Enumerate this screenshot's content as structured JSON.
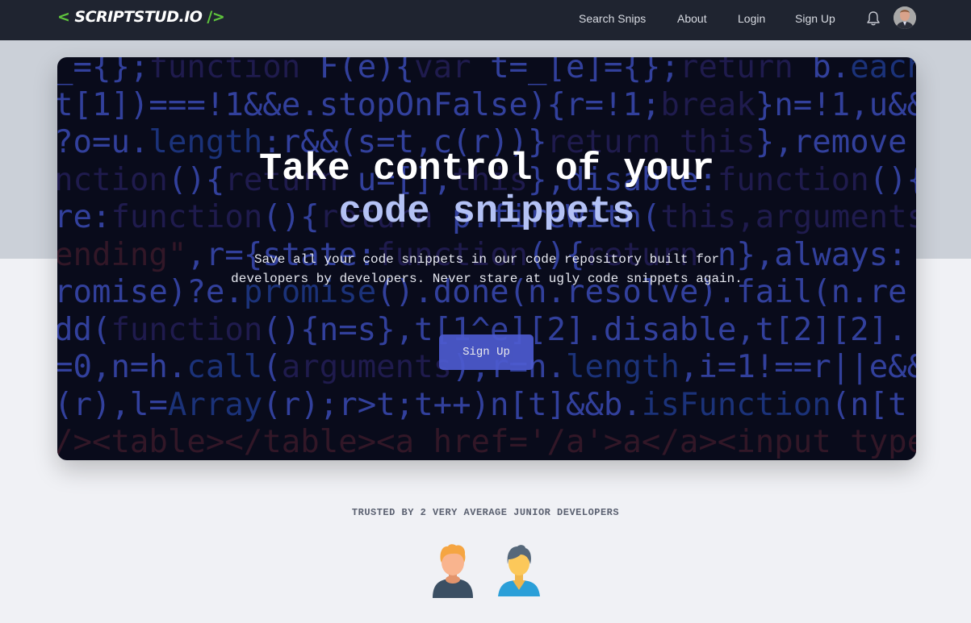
{
  "navbar": {
    "logo": {
      "open": "<",
      "name": "SCRIPTSTUD.IO",
      "close": "/>"
    },
    "links": [
      "Search Snips",
      "About",
      "Login",
      "Sign Up"
    ],
    "icons": [
      "bell-icon",
      "user-avatar"
    ]
  },
  "hero": {
    "title_line1": "Take control of your",
    "title_line2": "code snippets",
    "description": "Save all your code snippets in our code repository built for developers by developers. Never stare at ugly code snippets again.",
    "cta_label": "Sign Up",
    "code_background": [
      [
        [
          "b",
          "_={};"
        ],
        [
          "d",
          "function "
        ],
        [
          "b",
          "F(e){"
        ],
        [
          "d",
          "var "
        ],
        [
          "b",
          "t=_[e]={};"
        ],
        [
          "d",
          "return "
        ],
        [
          "b",
          "b."
        ],
        [
          "m",
          "each"
        ]
      ],
      [
        [
          "b",
          "t[1])===!1&&e.stopOnFalse){r=!1;"
        ],
        [
          "d",
          "break"
        ],
        [
          "b",
          "}n=!1,u&&"
        ]
      ],
      [
        [
          "b",
          "?o=u."
        ],
        [
          "m",
          "length"
        ],
        [
          "b",
          ":r&&(s=t,c(r))}"
        ],
        [
          "d",
          "return this"
        ],
        [
          "b",
          "},remove"
        ]
      ],
      [
        [
          "d",
          "nction"
        ],
        [
          "b",
          "(){"
        ],
        [
          "d",
          "return "
        ],
        [
          "b",
          "u=[],"
        ],
        [
          "d",
          "this"
        ],
        [
          "b",
          "},disable:"
        ],
        [
          "d",
          "function"
        ],
        [
          "b",
          "(){"
        ]
      ],
      [
        [
          "b",
          "re:"
        ],
        [
          "d",
          "function"
        ],
        [
          "b",
          "(){"
        ],
        [
          "d",
          "return "
        ],
        [
          "b",
          "p.fireWith("
        ],
        [
          "d",
          "this,arguments"
        ]
      ],
      [
        [
          "r",
          "ending\""
        ],
        [
          "b",
          ",r={state:"
        ],
        [
          "d",
          "function"
        ],
        [
          "b",
          "(){"
        ],
        [
          "d",
          "return "
        ],
        [
          "b",
          "n},always:"
        ]
      ],
      [
        [
          "b",
          "romise)?e."
        ],
        [
          "m",
          "promise"
        ],
        [
          "b",
          "().done(n.resolve).fail(n.re"
        ]
      ],
      [
        [
          "b",
          "dd("
        ],
        [
          "d",
          "function"
        ],
        [
          "b",
          "(){n=s},t[1^e][2].disable,t[2][2]."
        ]
      ],
      [
        [
          "b",
          "=0,n=h."
        ],
        [
          "m",
          "call"
        ],
        [
          "b",
          "("
        ],
        [
          "d",
          "arguments"
        ],
        [
          "b",
          "),r=n."
        ],
        [
          "m",
          "length"
        ],
        [
          "b",
          ",i=1!==r||e&&"
        ]
      ],
      [
        [
          "b",
          "(r),l="
        ],
        [
          "m",
          "Array"
        ],
        [
          "b",
          "(r);r>t;t++)n[t]&&b."
        ],
        [
          "m",
          "isFunction"
        ],
        [
          "b",
          "(n[t"
        ]
      ],
      [
        [
          "r",
          "/><table></table><a href='/a'>a</a><input type"
        ]
      ]
    ]
  },
  "trusted": {
    "text": "TRUSTED BY 2 VERY AVERAGE JUNIOR DEVELOPERS",
    "developers": [
      "developer-avatar-orange-hair",
      "developer-avatar-blue-shirt"
    ]
  },
  "colors": {
    "navbar_bg": "#1f2430",
    "logo_accent": "#5fc53d",
    "hero_accent_text": "#b4c2f5",
    "cta_bg": "#4d5bd0",
    "page_bg": "#f0f1f5",
    "band_bg": "#cbd0d8"
  }
}
